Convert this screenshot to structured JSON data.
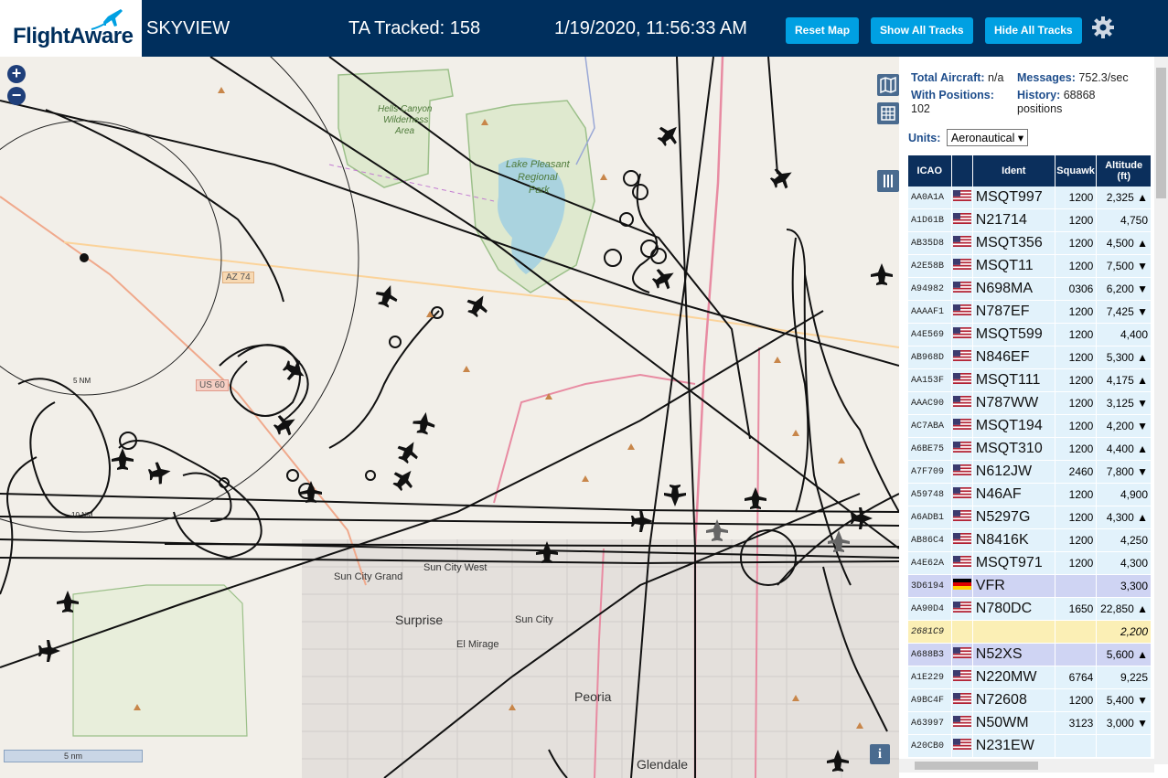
{
  "header": {
    "logo_text": "FlightAware",
    "app_name": "SKYVIEW",
    "tracked": "TA Tracked: 158",
    "datetime": "1/19/2020, 11:56:33 AM",
    "buttons": {
      "reset": "Reset Map",
      "show": "Show All Tracks",
      "hide": "Hide All Tracks"
    },
    "settings_icon": "gear-icon"
  },
  "map": {
    "zoom_in": "+",
    "zoom_out": "−",
    "scale_label": "5 nm",
    "labels": {
      "hells_canyon": "Hells Canyon",
      "wilderness": "Wilderness",
      "area": "Area",
      "lake": "Lake Pleasant",
      "regional": "Regional",
      "park": "Park",
      "az74": "AZ 74",
      "us60": "US 60",
      "ring5": "5 NM",
      "ring10": "10 NM",
      "sun_city_grand": "Sun City Grand",
      "sun_city_west": "Sun City West",
      "surprise": "Surprise",
      "sun_city": "Sun City",
      "el_mirage": "El Mirage",
      "peoria": "Peoria",
      "glendale": "Glendale"
    },
    "info_icon": "i"
  },
  "sidebar": {
    "stats": {
      "total_label": "Total Aircraft:",
      "total_value": "n/a",
      "messages_label": "Messages:",
      "messages_value": "752.3/sec",
      "positions_label": "With Positions:",
      "positions_value": "102",
      "history_label": "History:",
      "history_value": "68868",
      "history_unit": "positions"
    },
    "units_label": "Units:",
    "units_value": "Aeronautical",
    "table": {
      "headers": {
        "icao": "ICAO",
        "ident": "Ident",
        "squawk": "Squawk",
        "altitude": "Altitude",
        "altitude_unit": "(ft)"
      },
      "rows": [
        {
          "icao": "AA0A1A",
          "flag": "us",
          "ident": "MSQT997",
          "squawk": "1200",
          "alt": "2,325 ▲",
          "style": "norm"
        },
        {
          "icao": "A1D61B",
          "flag": "us",
          "ident": "N21714",
          "squawk": "1200",
          "alt": "4,750",
          "style": "norm"
        },
        {
          "icao": "AB35D8",
          "flag": "us",
          "ident": "MSQT356",
          "squawk": "1200",
          "alt": "4,500 ▲",
          "style": "norm"
        },
        {
          "icao": "A2E58B",
          "flag": "us",
          "ident": "MSQT11",
          "squawk": "1200",
          "alt": "7,500 ▼",
          "style": "norm"
        },
        {
          "icao": "A94982",
          "flag": "us",
          "ident": "N698MA",
          "squawk": "0306",
          "alt": "6,200 ▼",
          "style": "norm"
        },
        {
          "icao": "AAAAF1",
          "flag": "us",
          "ident": "N787EF",
          "squawk": "1200",
          "alt": "7,425 ▼",
          "style": "norm"
        },
        {
          "icao": "A4E569",
          "flag": "us",
          "ident": "MSQT599",
          "squawk": "1200",
          "alt": "4,400",
          "style": "norm"
        },
        {
          "icao": "AB968D",
          "flag": "us",
          "ident": "N846EF",
          "squawk": "1200",
          "alt": "5,300 ▲",
          "style": "norm"
        },
        {
          "icao": "AA153F",
          "flag": "us",
          "ident": "MSQT111",
          "squawk": "1200",
          "alt": "4,175 ▲",
          "style": "norm"
        },
        {
          "icao": "AAAC90",
          "flag": "us",
          "ident": "N787WW",
          "squawk": "1200",
          "alt": "3,125 ▼",
          "style": "norm"
        },
        {
          "icao": "AC7ABA",
          "flag": "us",
          "ident": "MSQT194",
          "squawk": "1200",
          "alt": "4,200 ▼",
          "style": "norm"
        },
        {
          "icao": "A6BE75",
          "flag": "us",
          "ident": "MSQT310",
          "squawk": "1200",
          "alt": "4,400 ▲",
          "style": "norm"
        },
        {
          "icao": "A7F709",
          "flag": "us",
          "ident": "N612JW",
          "squawk": "2460",
          "alt": "7,800 ▼",
          "style": "norm"
        },
        {
          "icao": "A59748",
          "flag": "us",
          "ident": "N46AF",
          "squawk": "1200",
          "alt": "4,900",
          "style": "norm"
        },
        {
          "icao": "A6ADB1",
          "flag": "us",
          "ident": "N5297G",
          "squawk": "1200",
          "alt": "4,300 ▲",
          "style": "norm"
        },
        {
          "icao": "AB86C4",
          "flag": "us",
          "ident": "N8416K",
          "squawk": "1200",
          "alt": "4,250",
          "style": "norm"
        },
        {
          "icao": "A4E62A",
          "flag": "us",
          "ident": "MSQT971",
          "squawk": "1200",
          "alt": "4,300",
          "style": "norm"
        },
        {
          "icao": "3D6194",
          "flag": "de",
          "ident": "VFR",
          "squawk": "",
          "alt": "3,300",
          "style": "blue"
        },
        {
          "icao": "AA90D4",
          "flag": "us",
          "ident": "N780DC",
          "squawk": "1650",
          "alt": "22,850 ▲",
          "style": "norm"
        },
        {
          "icao": "2681C9",
          "flag": "",
          "ident": "",
          "squawk": "",
          "alt": "2,200",
          "style": "yel"
        },
        {
          "icao": "A688B3",
          "flag": "us",
          "ident": "N52XS",
          "squawk": "",
          "alt": "5,600 ▲",
          "style": "blue"
        },
        {
          "icao": "A1E229",
          "flag": "us",
          "ident": "N220MW",
          "squawk": "6764",
          "alt": "9,225",
          "style": "norm"
        },
        {
          "icao": "A9BC4F",
          "flag": "us",
          "ident": "N72608",
          "squawk": "1200",
          "alt": "5,400 ▼",
          "style": "norm"
        },
        {
          "icao": "A63997",
          "flag": "us",
          "ident": "N50WM",
          "squawk": "3123",
          "alt": "3,000 ▼",
          "style": "norm"
        },
        {
          "icao": "A20CB0",
          "flag": "us",
          "ident": "N231EW",
          "squawk": "",
          "alt": "",
          "style": "norm"
        }
      ]
    }
  }
}
